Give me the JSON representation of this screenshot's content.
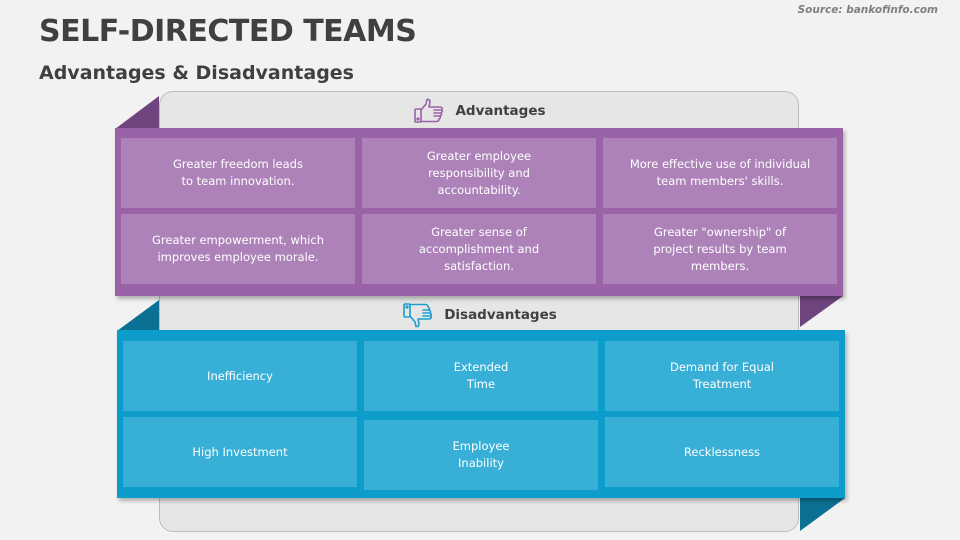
{
  "header": {
    "title": "SELF-DIRECTED TEAMS",
    "subtitle": "Advantages & Disadvantages",
    "source": "Source: bankofinfo.com"
  },
  "colors": {
    "advantages_band": "#9a63a8",
    "advantages_cell": "#ad82b9",
    "advantages_fold": "#70457f",
    "disadvantages_band": "#0d9dcb",
    "disadvantages_cell": "#38afd6",
    "disadvantages_fold": "#0a7194",
    "panel": "#e6e6e6",
    "text_dark": "#404040"
  },
  "advantages": {
    "label": "Advantages",
    "icon": "thumbs-up-icon",
    "items": [
      "Greater freedom leads\nto team innovation.",
      "Greater employee\nresponsibility and\naccountability.",
      "More effective use of individual\nteam members' skills.",
      "Greater empowerment, which\nimproves employee morale.",
      "Greater sense of\naccomplishment and\nsatisfaction.",
      "Greater \"ownership\" of\nproject results by team\nmembers."
    ]
  },
  "disadvantages": {
    "label": "Disadvantages",
    "icon": "thumbs-down-icon",
    "items": [
      "Inefficiency",
      "Extended\nTime",
      "Demand for Equal\nTreatment",
      "High Investment",
      "Employee\nInability",
      "Recklessness"
    ]
  }
}
